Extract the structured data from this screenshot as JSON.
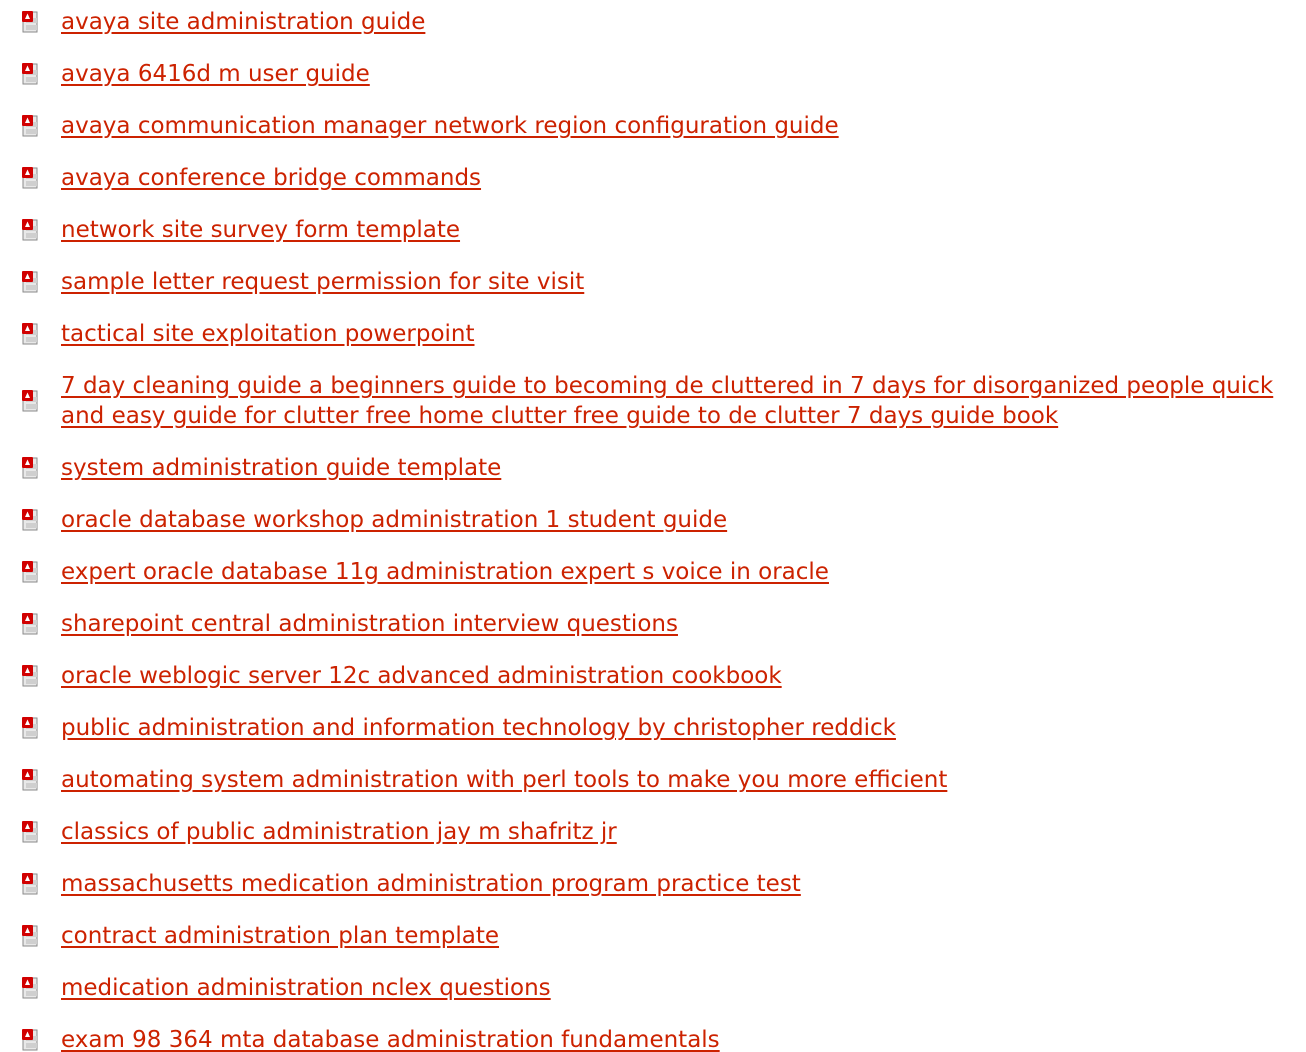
{
  "icon": "pdf-file-icon",
  "link_color": "#cc2200",
  "items": [
    {
      "label": "avaya site administration guide"
    },
    {
      "label": "avaya 6416d m user guide"
    },
    {
      "label": "avaya communication manager network region configuration guide"
    },
    {
      "label": "avaya conference bridge commands"
    },
    {
      "label": "network site survey form template"
    },
    {
      "label": "sample letter request permission for site visit"
    },
    {
      "label": "tactical site exploitation powerpoint"
    },
    {
      "label": "7 day cleaning guide a beginners guide to becoming de cluttered in 7 days for disorganized people quick and easy guide for clutter free home clutter free guide to de clutter 7 days guide book"
    },
    {
      "label": "system administration guide template"
    },
    {
      "label": "oracle database workshop administration 1 student guide"
    },
    {
      "label": "expert oracle database 11g administration expert s voice in oracle"
    },
    {
      "label": "sharepoint central administration interview questions"
    },
    {
      "label": "oracle weblogic server 12c advanced administration cookbook"
    },
    {
      "label": "public administration and information technology by christopher reddick"
    },
    {
      "label": "automating system administration with perl tools to make you more efficient"
    },
    {
      "label": "classics of public administration jay m shafritz jr"
    },
    {
      "label": "massachusetts medication administration program practice test"
    },
    {
      "label": "contract administration plan template"
    },
    {
      "label": "medication administration nclex questions"
    },
    {
      "label": "exam 98 364 mta database administration fundamentals"
    }
  ]
}
